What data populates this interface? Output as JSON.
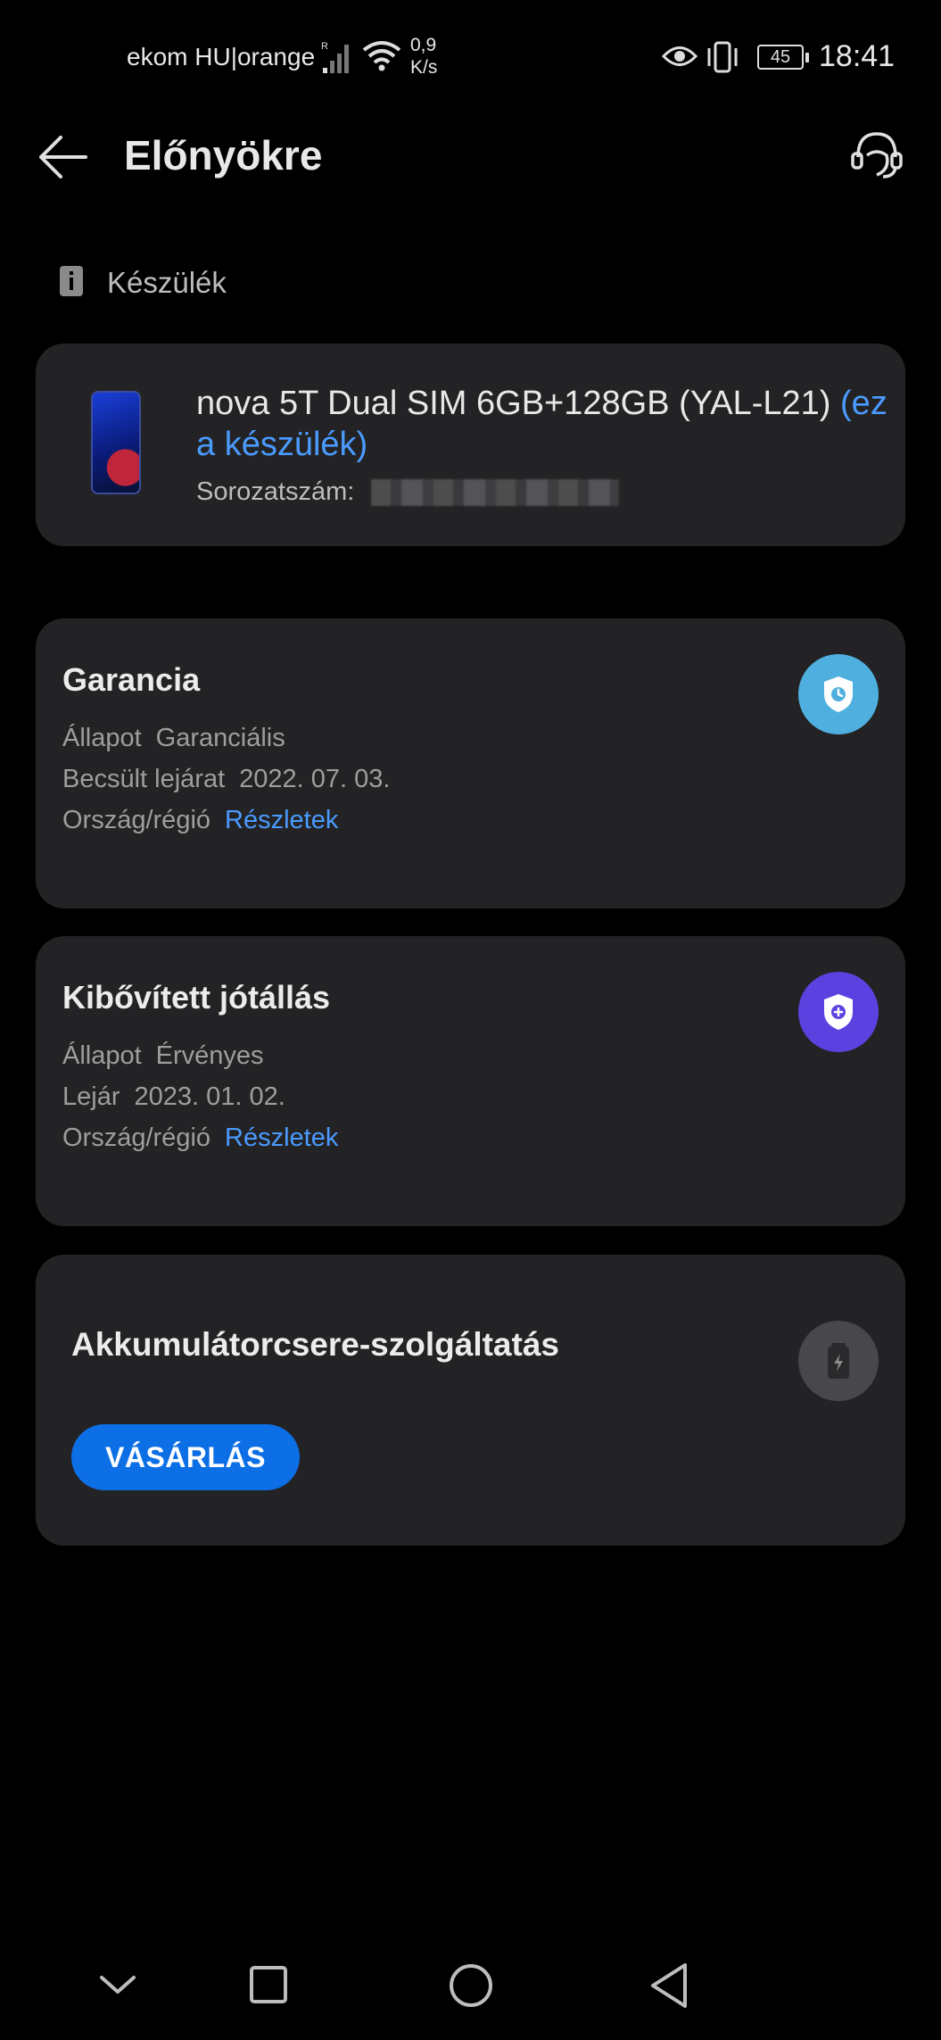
{
  "status_bar": {
    "carrier": "ekom HU|orange",
    "signal_tag": "R",
    "speed": "0,9",
    "speed_unit": "K/s",
    "battery": "45",
    "time": "18:41"
  },
  "header": {
    "title": "Előnyökre"
  },
  "section": {
    "label": "Készülék"
  },
  "device": {
    "name": "nova 5T Dual SIM 6GB+128GB (YAL-L21)",
    "this_device": "(ez a készülék)",
    "serial_label": "Sorozatszám:"
  },
  "warranty": {
    "title": "Garancia",
    "status_label": "Állapot",
    "status_value": "Garanciális",
    "expiry_label": "Becsült lejárat",
    "expiry_value": "2022. 07. 03.",
    "region_label": "Ország/régió",
    "region_link": "Részletek"
  },
  "extended": {
    "title": "Kibővített jótállás",
    "status_label": "Állapot",
    "status_value": "Érvényes",
    "expiry_label": "Lejár",
    "expiry_value": "2023. 01. 02.",
    "region_label": "Ország/régió",
    "region_link": "Részletek"
  },
  "battery_service": {
    "title": "Akkumulátorcsere-szolgáltatás",
    "buy_label": "VÁSÁRLÁS"
  },
  "colors": {
    "accent": "#4a9bff",
    "button": "#0d6fe6",
    "warranty_badge": "#4fb0e0",
    "extended_badge": "#5b42e0"
  }
}
